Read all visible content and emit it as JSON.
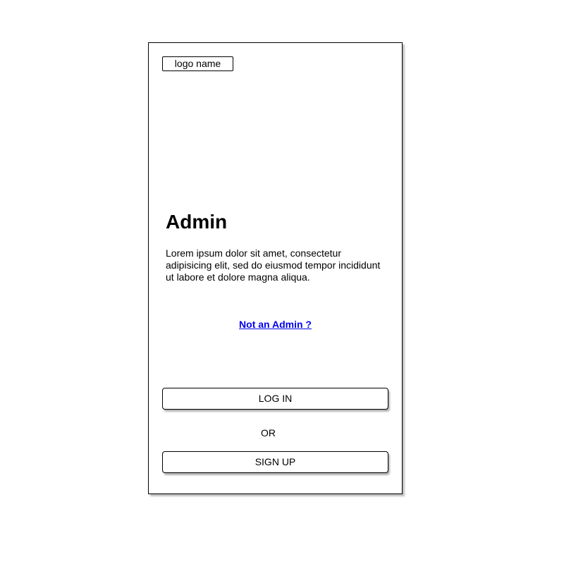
{
  "header": {
    "logo_label": "logo name"
  },
  "main": {
    "title": "Admin",
    "description": "Lorem ipsum dolor sit amet, consectetur adipisicing elit, sed do eiusmod tempor incididunt ut labore et dolore magna aliqua.",
    "not_admin_link": "Not  an Admin ?"
  },
  "actions": {
    "login_label": "LOG IN",
    "or_label": "OR",
    "signup_label": "SIGN UP"
  },
  "colors": {
    "link": "#0000ee",
    "border": "#000000",
    "background": "#ffffff"
  }
}
